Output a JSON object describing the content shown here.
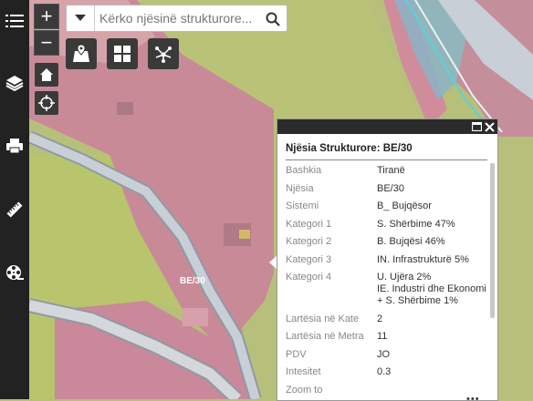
{
  "search": {
    "placeholder": "Kërko njësinë strukturore..."
  },
  "map": {
    "parcel_label": "BE/30"
  },
  "popup": {
    "title": "Njësia Strukturore: BE/30",
    "rows": [
      {
        "label": "Bashkia",
        "value": "Tiranë"
      },
      {
        "label": "Njësia",
        "value": "BE/30"
      },
      {
        "label": "Sistemi",
        "value": "B_ Bujqësor"
      },
      {
        "label": "Kategori 1",
        "value": "S. Shërbime 47%"
      },
      {
        "label": "Kategori 2",
        "value": "B. Bujqësi 46%"
      },
      {
        "label": "Kategori 3",
        "value": "IN. Infrastrukturë 5%"
      },
      {
        "label": "Kategori 4",
        "value": "U. Ujëra 2%\nIE. Industri dhe Ekonomi + S. Shërbime 1%"
      },
      {
        "label": "Lartësia në Kate",
        "value": "2"
      },
      {
        "label": "Lartësia në Metra",
        "value": "11"
      },
      {
        "label": "PDV",
        "value": "JO"
      },
      {
        "label": "Intesitet",
        "value": "0.3"
      },
      {
        "label": "Zoom to",
        "value": ""
      }
    ],
    "more": "•••"
  },
  "colors": {
    "sidebar": "#222222",
    "parcel_pink": "#c98a98",
    "parcel_green": "#b8c56c",
    "road": "#c9cfd6",
    "highlight_blue": "#7bb8c8"
  },
  "icons": {
    "sidebar": [
      "menu-icon",
      "layers-icon",
      "print-icon",
      "ruler-icon",
      "film-reel-icon"
    ],
    "tools": [
      "add-point-icon",
      "grid-icon",
      "network-icon"
    ]
  }
}
